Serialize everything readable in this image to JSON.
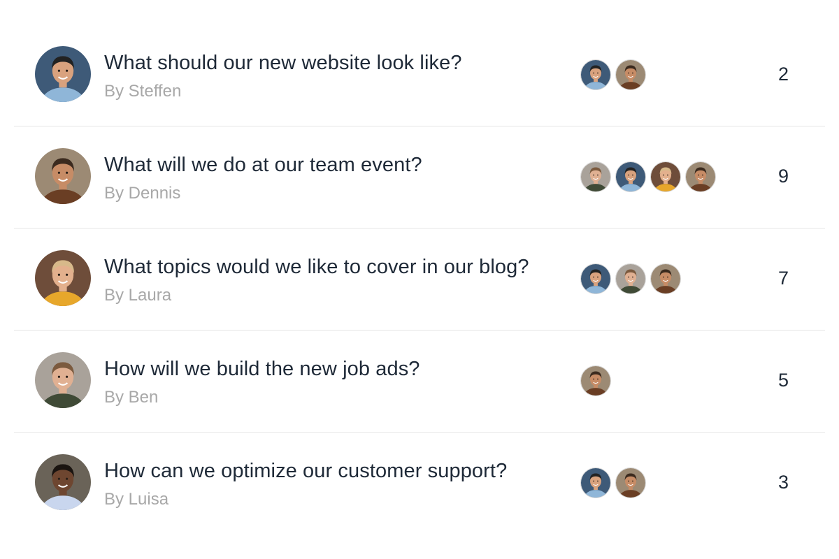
{
  "people": {
    "steffen": {
      "bg": "#3e5a78",
      "skin": "#d9a27e",
      "hair": "#222222",
      "shirt": "#8fb6d8"
    },
    "dennis": {
      "bg": "#9c8a74",
      "skin": "#c78c66",
      "hair": "#3b2a1e",
      "shirt": "#6a3e24"
    },
    "laura": {
      "bg": "#6e4d3a",
      "skin": "#e3b08d",
      "hair": "#d7b98a",
      "shirt": "#e7a72b"
    },
    "ben": {
      "bg": "#a9a29a",
      "skin": "#e0b092",
      "hair": "#7b5a3e",
      "shirt": "#3f4a36"
    },
    "luisa": {
      "bg": "#6a6358",
      "skin": "#6e4630",
      "hair": "#1a1410",
      "shirt": "#c9d6ee"
    }
  },
  "topics": [
    {
      "title": "What should our new website look like?",
      "author": "By Steffen",
      "avatar": "steffen",
      "participants": [
        "steffen",
        "dennis"
      ],
      "count": "2"
    },
    {
      "title": "What will we do at our team event?",
      "author": "By Dennis",
      "avatar": "dennis",
      "participants": [
        "ben",
        "steffen",
        "laura",
        "dennis"
      ],
      "count": "9"
    },
    {
      "title": "What topics would we like to cover in our blog?",
      "author": "By Laura",
      "avatar": "laura",
      "participants": [
        "steffen",
        "ben",
        "dennis"
      ],
      "count": "7"
    },
    {
      "title": "How will we build the new job ads?",
      "author": "By Ben",
      "avatar": "ben",
      "participants": [
        "dennis"
      ],
      "count": "5"
    },
    {
      "title": "How can we optimize our customer support?",
      "author": "By Luisa",
      "avatar": "luisa",
      "participants": [
        "steffen",
        "dennis"
      ],
      "count": "3"
    }
  ]
}
